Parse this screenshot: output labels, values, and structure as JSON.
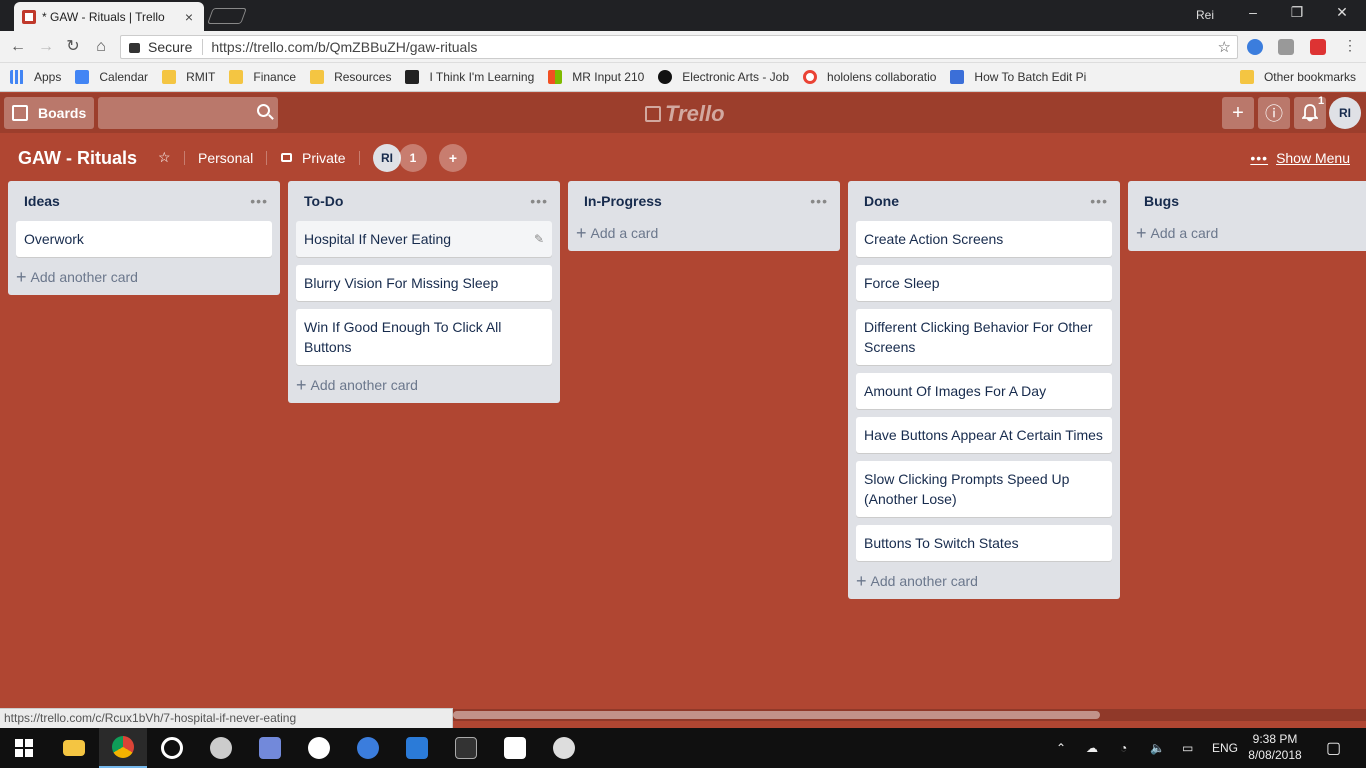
{
  "browser": {
    "tab_title": "* GAW - Rituals | Trello",
    "tab_close": "×",
    "profile_name": "Rei",
    "window_controls": {
      "minimize": "–",
      "restore": "❐",
      "close": "✕"
    },
    "security_label": "Secure",
    "url": "https://trello.com/b/QmZBBuZH/gaw-rituals",
    "nav": {
      "back": "←",
      "forward": "→",
      "reload": "↻",
      "home": "⌂",
      "bookmark_star": "☆"
    },
    "bookmarks": [
      {
        "label": "Apps",
        "icon": "apps-grid-icon"
      },
      {
        "label": "Calendar",
        "icon": "calendar-icon"
      },
      {
        "label": "RMIT",
        "icon": "folder-icon"
      },
      {
        "label": "Finance",
        "icon": "folder-icon"
      },
      {
        "label": "Resources",
        "icon": "folder-icon"
      },
      {
        "label": "I Think I'm Learning",
        "icon": "trello-icon"
      },
      {
        "label": "MR Input 210",
        "icon": "windows-icon"
      },
      {
        "label": "Electronic Arts - Job",
        "icon": "ea-icon"
      },
      {
        "label": "hololens collaboratio",
        "icon": "google-icon"
      },
      {
        "label": "How To Batch Edit Pi",
        "icon": "plugin-icon"
      }
    ],
    "other_bookmarks": "Other bookmarks",
    "status_url": "https://trello.com/c/Rcux1bVh/7-hospital-if-never-eating"
  },
  "trello_header": {
    "boards_label": "Boards",
    "logo_text": "Trello",
    "add_icon": "+",
    "info_icon": "ⓘ",
    "notification_count": "1",
    "user_initials": "RI"
  },
  "board": {
    "title": "GAW - Rituals",
    "star": "☆",
    "team": "Personal",
    "visibility": "Private",
    "member_initials": "RI",
    "member_count": "1",
    "add_member_icon": "+",
    "show_menu_dots": "•••",
    "show_menu": "Show Menu"
  },
  "lists": [
    {
      "title": "Ideas",
      "menu": "•••",
      "cards": [
        "Overwork"
      ],
      "add_label": "Add another card"
    },
    {
      "title": "To-Do",
      "menu": "•••",
      "cards": [
        "Hospital If Never Eating",
        "Blurry Vision For Missing Sleep",
        "Win If Good Enough To Click All Buttons"
      ],
      "add_label": "Add another card"
    },
    {
      "title": "In-Progress",
      "menu": "•••",
      "cards": [],
      "add_label": "Add a card"
    },
    {
      "title": "Done",
      "menu": "•••",
      "cards": [
        "Create Action Screens",
        "Force Sleep",
        "Different Clicking Behavior For Other Screens",
        "Amount Of Images For A Day",
        "Have Buttons Appear At Certain Times",
        "Slow Clicking Prompts Speed Up (Another Lose)",
        "Buttons To Switch States"
      ],
      "add_label": "Add another card"
    },
    {
      "title": "Bugs",
      "menu": "",
      "cards": [],
      "add_label": "Add a card"
    }
  ],
  "taskbar": {
    "language": "ENG",
    "time": "9:38 PM",
    "date": "8/08/2018"
  },
  "colors": {
    "board_background": "#b04632",
    "header_background": "#9c3e2c",
    "list_background": "#dfe1e6",
    "taskbar_background": "#101010"
  }
}
